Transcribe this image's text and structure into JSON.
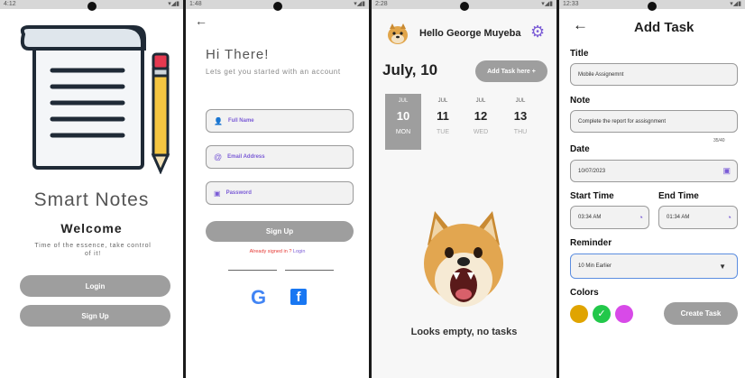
{
  "screens": {
    "welcome": {
      "status_time": "4:12",
      "app_name": "Smart Notes",
      "heading": "Welcome",
      "tagline": "Time of the essence, take control of it!",
      "login_label": "Login",
      "signup_label": "Sign Up"
    },
    "signup": {
      "status_time": "1:48",
      "greeting": "Hi There!",
      "subtitle": "Lets get you started with an account",
      "full_name_placeholder": "Full Name",
      "email_placeholder": "Email Address",
      "password_placeholder": "Password",
      "signup_label": "Sign Up",
      "already_prefix": "Already signed in ? ",
      "login_link": "Login",
      "google_glyph": "G",
      "facebook_glyph": "f"
    },
    "home": {
      "status_time": "2:28",
      "greeting": "Hello George Muyeba",
      "date_heading": "July, 10",
      "add_task_label": "Add Task here +",
      "days": [
        {
          "month": "JUL",
          "day": "10",
          "weekday": "MON",
          "selected": true
        },
        {
          "month": "JUL",
          "day": "11",
          "weekday": "TUE",
          "selected": false
        },
        {
          "month": "JUL",
          "day": "12",
          "weekday": "WED",
          "selected": false
        },
        {
          "month": "JUL",
          "day": "13",
          "weekday": "THU",
          "selected": false
        }
      ],
      "empty_message": "Looks empty, no tasks"
    },
    "add_task": {
      "status_time": "12:33",
      "title": "Add Task",
      "title_label": "Title",
      "title_value": "Mobile Assignemnt",
      "note_label": "Note",
      "note_value": "Complete the report for assisgnment",
      "note_counter": "35/40",
      "date_label": "Date",
      "date_value": "10/07/2023",
      "start_label": "Start Time",
      "start_value": "03:34 AM",
      "end_label": "End Time",
      "end_value": "01:34 AM",
      "reminder_label": "Reminder",
      "reminder_value": "10 Min Earlier",
      "colors_label": "Colors",
      "colors": [
        "#e0a400",
        "#22c84a",
        "#d84ae8"
      ],
      "selected_color_index": 1,
      "create_label": "Create Task"
    }
  },
  "theme": {
    "accent": "#7b5cd6",
    "button_gray": "#9e9e9e",
    "link_red": "#e53935"
  }
}
